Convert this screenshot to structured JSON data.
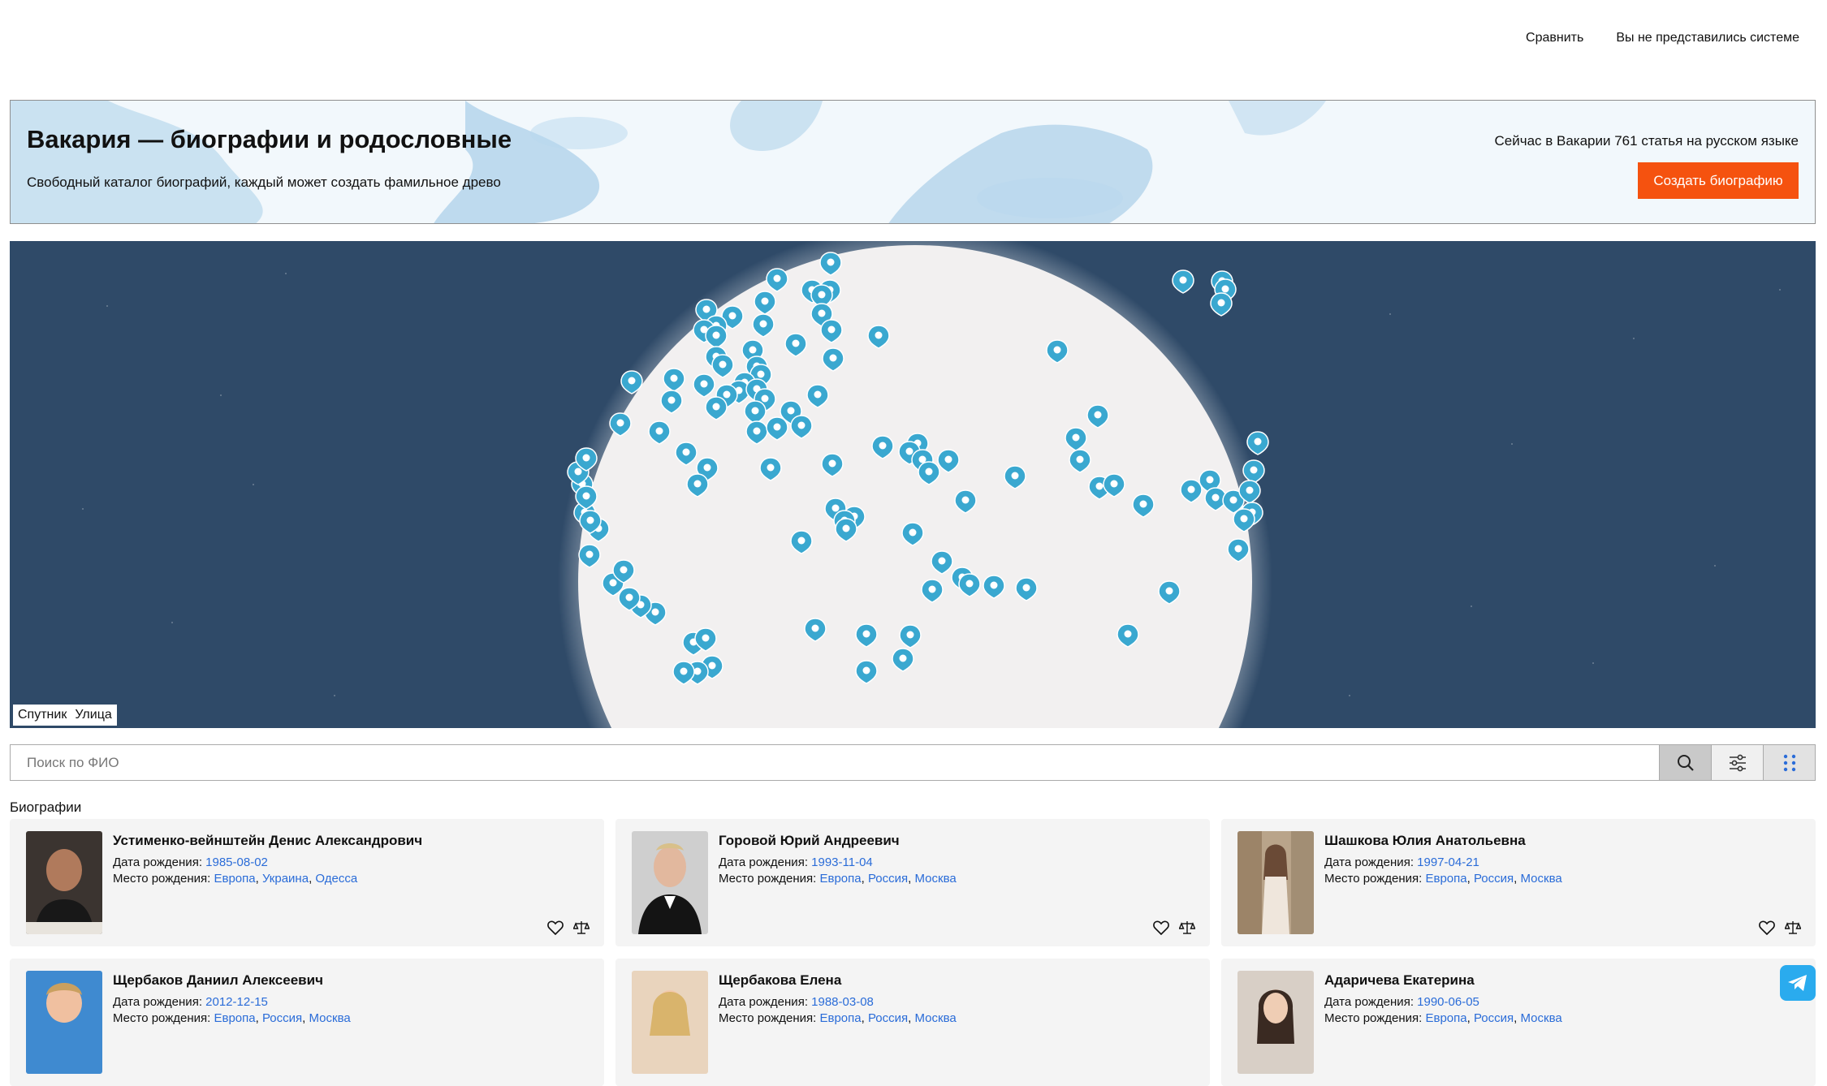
{
  "nav": {
    "compare": "Сравнить",
    "login_status": "Вы не представились системе"
  },
  "banner": {
    "title": "Вакария — биографии и родословные",
    "subtitle": "Свободный каталог биографий, каждый может создать фамильное древо",
    "count_text": "Сейчас в Вакарии 761 статья на русском языке",
    "create_button": "Создать биографию"
  },
  "map": {
    "layer_satellite": "Спутник",
    "layer_street": "Улица",
    "marker_icon": "map-pin-icon"
  },
  "search": {
    "placeholder": "Поиск по ФИО",
    "value": ""
  },
  "section": {
    "title": "Биографии"
  },
  "labels": {
    "birth_date": "Дата рождения: ",
    "birth_place": "Место рождения: "
  },
  "biographies": [
    {
      "name": "Устименко-вейнштейн Денис Александрович",
      "birth_date": "1985-08-02",
      "place": [
        "Европа",
        "Украина",
        "Одесса"
      ]
    },
    {
      "name": "Горовой Юрий Андреевич",
      "birth_date": "1993-11-04",
      "place": [
        "Европа",
        "Россия",
        "Москва"
      ]
    },
    {
      "name": "Шашкова Юлия Анатольевна",
      "birth_date": "1997-04-21",
      "place": [
        "Европа",
        "Россия",
        "Москва"
      ]
    },
    {
      "name": "Щербаков Даниил Алексеевич",
      "birth_date": "2012-12-15",
      "place": [
        "Европа",
        "Россия",
        "Москва"
      ]
    },
    {
      "name": "Щербакова Елена",
      "birth_date": "1988-03-08",
      "place": [
        "Европа",
        "Россия",
        "Москва"
      ]
    },
    {
      "name": "Адаричева Екатерина",
      "birth_date": "1990-06-05",
      "place": [
        "Европа",
        "Россия",
        "Москва"
      ]
    }
  ],
  "colors": {
    "accent": "#f5520f",
    "link": "#2a6cd8",
    "marker": "#3aa8d0",
    "map_bg": "#2f4a68",
    "telegram": "#2aabee"
  }
}
